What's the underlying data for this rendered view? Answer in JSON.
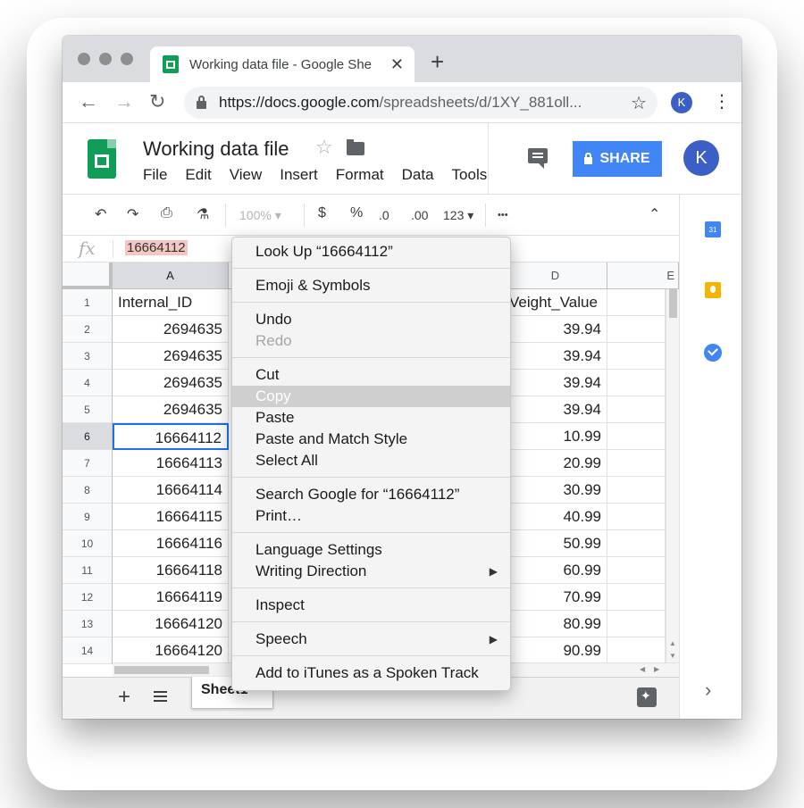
{
  "browser": {
    "tab_title": "Working data file - Google She",
    "new_tab": "+",
    "close": "✕",
    "url_host": "https://docs.google.com",
    "url_path": "/spreadsheets/d/1XY_881oll...",
    "profile_initial": "K"
  },
  "sheets": {
    "title": "Working data file",
    "menu": [
      "File",
      "Edit",
      "View",
      "Insert",
      "Format",
      "Data",
      "Tools"
    ],
    "share_label": "SHARE",
    "profile_initial": "K"
  },
  "toolbar": {
    "zoom": "100%",
    "currency": "$",
    "percent": "%",
    "dec_less": ".0",
    "dec_more": ".00",
    "format_more": "123",
    "more": "•••"
  },
  "formula_bar": {
    "fx": "fx",
    "value": "16664112"
  },
  "grid": {
    "columns": [
      "A",
      "D",
      "E"
    ],
    "row_numbers": [
      "1",
      "2",
      "3",
      "4",
      "5",
      "6",
      "7",
      "8",
      "9",
      "10",
      "11",
      "12",
      "13",
      "14"
    ],
    "col_a": [
      "Internal_ID",
      "2694635",
      "2694635",
      "2694635",
      "2694635",
      "16664112",
      "16664113",
      "16664114",
      "16664115",
      "16664116",
      "16664118",
      "16664119",
      "16664120",
      "16664120"
    ],
    "col_d": [
      "Veight_Value",
      "39.94",
      "39.94",
      "39.94",
      "39.94",
      "10.99",
      "20.99",
      "30.99",
      "40.99",
      "50.99",
      "60.99",
      "70.99",
      "80.99",
      "90.99"
    ],
    "active_row": 6
  },
  "sheet_tabs": [
    "Sheet1"
  ],
  "side_panel": {
    "calendar_label": "31",
    "chevron": "›"
  },
  "context_menu": {
    "groups": [
      [
        "Look Up “16664112”"
      ],
      [
        "Emoji & Symbols"
      ],
      [
        "Undo",
        "Redo"
      ],
      [
        "Cut",
        "Copy",
        "Paste",
        "Paste and Match Style",
        "Select All"
      ],
      [
        "Search Google for “16664112”",
        "Print…"
      ],
      [
        "Language Settings",
        "Writing Direction"
      ],
      [
        "Inspect"
      ],
      [
        "Speech"
      ],
      [
        "Add to iTunes as a Spoken Track"
      ]
    ],
    "disabled": [
      "Redo"
    ],
    "highlighted": "Copy",
    "submenus": [
      "Writing Direction",
      "Speech"
    ]
  },
  "colors": {
    "sheets_green": "#0f9d58",
    "share_blue": "#4285f4",
    "selection_blue": "#1a73e8",
    "formula_highlight": "#f4c7c3"
  }
}
